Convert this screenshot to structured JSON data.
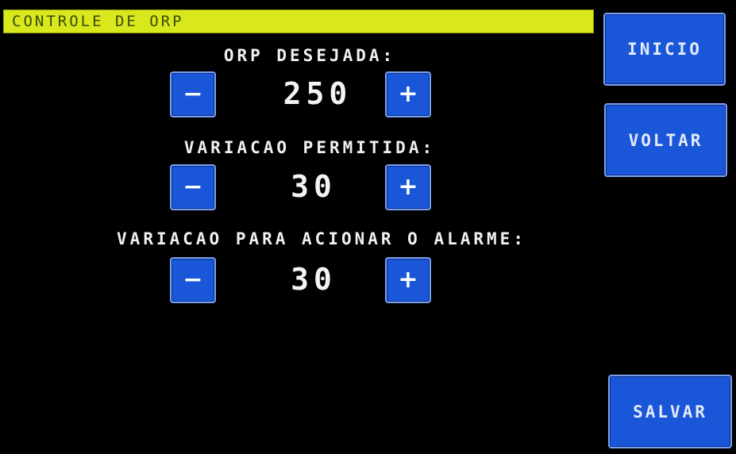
{
  "header": {
    "title": "CONTROLE DE ORP"
  },
  "controls": [
    {
      "label": "ORP DESEJADA:",
      "value": "250",
      "decrement_label": "−",
      "increment_label": "+"
    },
    {
      "label": "VARIACAO PERMITIDA:",
      "value": "30",
      "decrement_label": "−",
      "increment_label": "+"
    },
    {
      "label": "VARIACAO PARA ACIONAR O ALARME:",
      "value": "30",
      "decrement_label": "−",
      "increment_label": "+"
    }
  ],
  "nav": {
    "inicio_label": "INICIO",
    "voltar_label": "VOLTAR",
    "salvar_label": "SALVAR"
  },
  "colors": {
    "background": "#000000",
    "title_bar": "#d8e81c",
    "button": "#1a56d8",
    "text": "#eef1f4"
  }
}
